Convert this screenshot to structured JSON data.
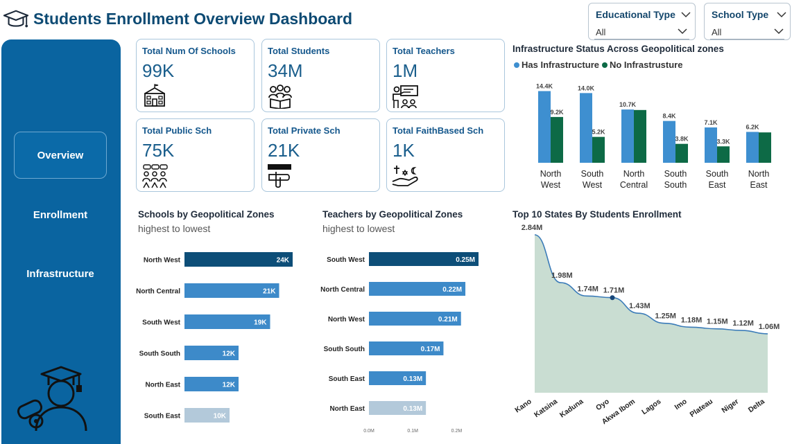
{
  "header": {
    "title": "Students Enrollment Overview Dashboard",
    "icon": "graduation-cap-icon"
  },
  "filters": [
    {
      "label": "Educational Type",
      "value": "All"
    },
    {
      "label": "School Type",
      "value": "All"
    }
  ],
  "sidebar": {
    "items": [
      {
        "label": "Overview",
        "active": true
      },
      {
        "label": "Enrollment",
        "active": false
      },
      {
        "label": "Infrastructure",
        "active": false
      }
    ],
    "illustration": "graduate-with-diploma-icon"
  },
  "kpis": [
    {
      "label": "Total Num Of Schools",
      "value": "99K",
      "icon": "school-building-icon"
    },
    {
      "label": "Total Students",
      "value": "34M",
      "icon": "students-reading-icon"
    },
    {
      "label": "Total Teachers",
      "value": "1M",
      "icon": "teacher-board-icon"
    },
    {
      "label": "Total Public Sch",
      "value": "75K",
      "icon": "public-group-icon"
    },
    {
      "label": "Total Private Sch",
      "value": "21K",
      "icon": "private-hand-icon"
    },
    {
      "label": "Total FaithBased Sch",
      "value": "1K",
      "icon": "faith-symbols-icon"
    }
  ],
  "colors": {
    "primary": "#0a64a0",
    "has_infra": "#3e8fd0",
    "no_infra": "#0d6a46",
    "bar_dark": "#0d4e78",
    "bar_mid": "#3d8ac9",
    "bar_light": "#b3c9da",
    "area_fill": "#c9ddd2",
    "area_line": "#3a7bb8"
  },
  "chart_data": [
    {
      "id": "infrastructure",
      "type": "bar",
      "title": "Infrastructure Status Across Geopolitical zones",
      "categories": [
        [
          "North",
          "West"
        ],
        [
          "South",
          "West"
        ],
        [
          "North",
          "Central"
        ],
        [
          "South",
          "South"
        ],
        [
          "South",
          "East"
        ],
        [
          "North",
          "East"
        ]
      ],
      "series": [
        {
          "name": "Has Infrastructure",
          "values": [
            14.4,
            14.0,
            10.7,
            8.4,
            7.1,
            6.2
          ],
          "labels": [
            "14.4K",
            "14.0K",
            "10.7K",
            "8.4K",
            "7.1K",
            "6.2K"
          ]
        },
        {
          "name": "No Infrastrusture",
          "values": [
            9.2,
            5.2,
            10.6,
            3.8,
            3.3,
            6.1
          ],
          "labels": [
            "9.2K",
            "5.2K",
            "",
            "3.8K",
            "3.3K",
            ""
          ]
        }
      ],
      "ylim": [
        0,
        16
      ]
    },
    {
      "id": "schools",
      "type": "bar",
      "orientation": "horizontal",
      "title": "Schools by Geopolitical Zones",
      "subtitle": "highest to lowest",
      "categories": [
        "North West",
        "North Central",
        "South West",
        "South South",
        "North East",
        "South East"
      ],
      "values": [
        24,
        21,
        19,
        12,
        12,
        10
      ],
      "labels": [
        "24K",
        "21K",
        "19K",
        "12K",
        "12K",
        "10K"
      ],
      "xlim": [
        0,
        24
      ]
    },
    {
      "id": "teachers",
      "type": "bar",
      "orientation": "horizontal",
      "title": "Teachers by Geopolitical Zones",
      "subtitle": "highest to lowest",
      "categories": [
        "South West",
        "North Central",
        "North West",
        "South South",
        "South East",
        "North East"
      ],
      "values": [
        0.25,
        0.22,
        0.21,
        0.17,
        0.13,
        0.13
      ],
      "labels": [
        "0.25M",
        "0.22M",
        "0.21M",
        "0.17M",
        "0.13M",
        "0.13M"
      ],
      "xticks": [
        "0.0M",
        "0.1M",
        "0.2M"
      ],
      "xlim": [
        0,
        0.25
      ]
    },
    {
      "id": "top-states",
      "type": "area",
      "title": "Top 10 States By Students Enrollment",
      "categories": [
        "Kano",
        "Katsina",
        "Kaduna",
        "Oyo",
        "Akwa Ibom",
        "Lagos",
        "Imo",
        "Plateau",
        "Niger",
        "Delta"
      ],
      "values": [
        2.84,
        1.98,
        1.74,
        1.71,
        1.43,
        1.25,
        1.18,
        1.15,
        1.12,
        1.06
      ],
      "labels": [
        "2.84M",
        "1.98M",
        "1.74M",
        "1.71M",
        "1.43M",
        "1.25M",
        "1.18M",
        "1.15M",
        "1.12M",
        "1.06M"
      ],
      "highlight_index": 3
    }
  ]
}
